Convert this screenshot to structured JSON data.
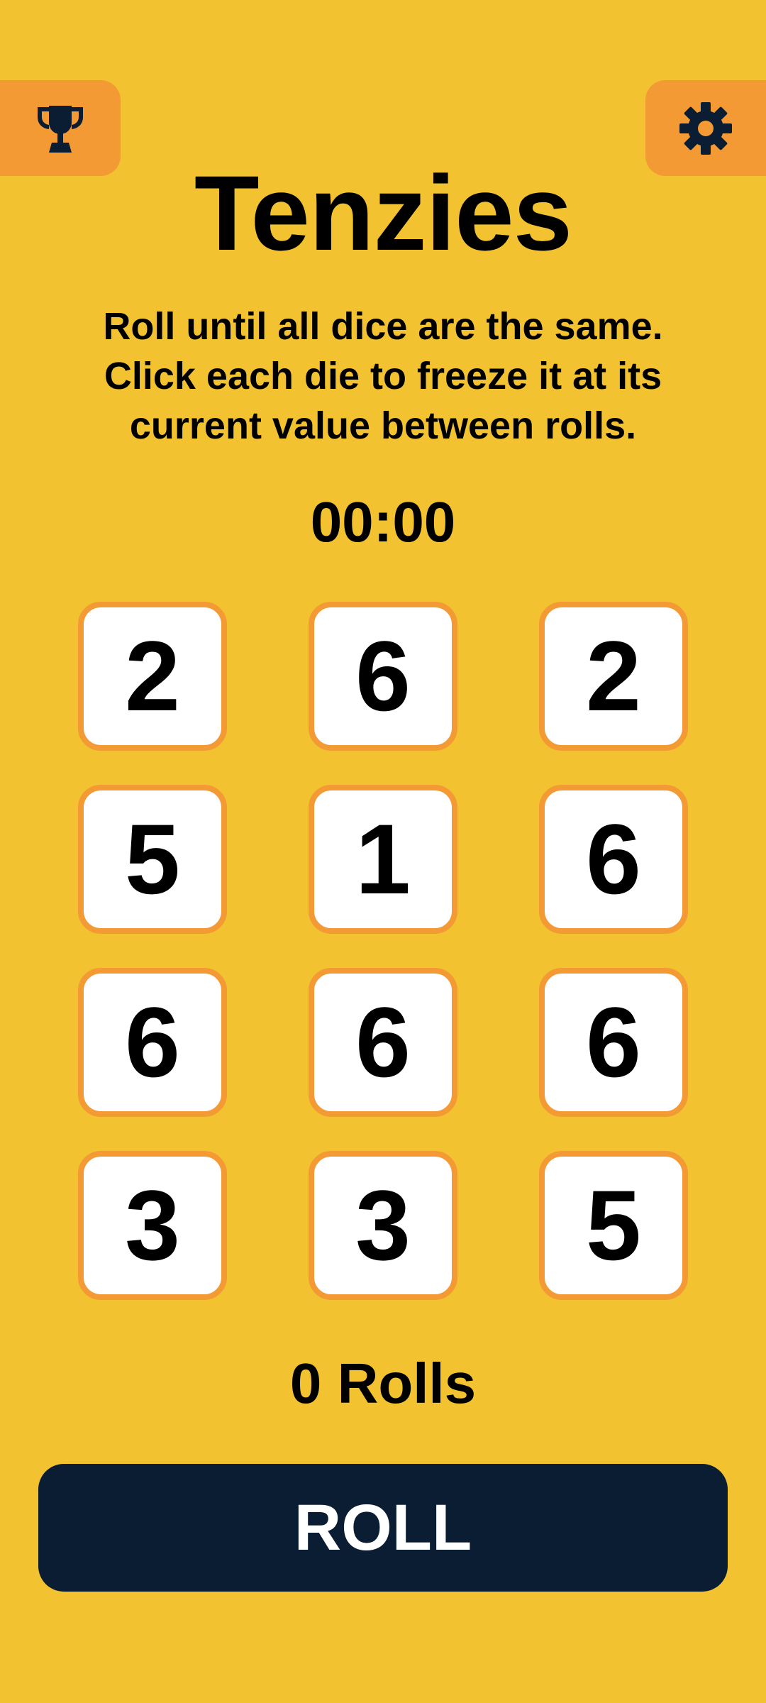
{
  "header": {
    "trophy_icon": "trophy-icon",
    "settings_icon": "gear-icon",
    "icon_color": "#0B1D33",
    "button_color": "#F39A35"
  },
  "game": {
    "title": "Tenzies",
    "instructions": "Roll until all dice are the same. Click each die to freeze it at its current value between rolls.",
    "timer": "00:00",
    "dice": [
      "2",
      "6",
      "2",
      "5",
      "1",
      "6",
      "6",
      "6",
      "6",
      "3",
      "3",
      "5"
    ],
    "rolls_label": "0 Rolls",
    "roll_button_label": "ROLL"
  },
  "colors": {
    "background": "#F2C230",
    "die_border": "#F39A35",
    "die_face": "#FFFFFF",
    "roll_button": "#0B1D33"
  }
}
